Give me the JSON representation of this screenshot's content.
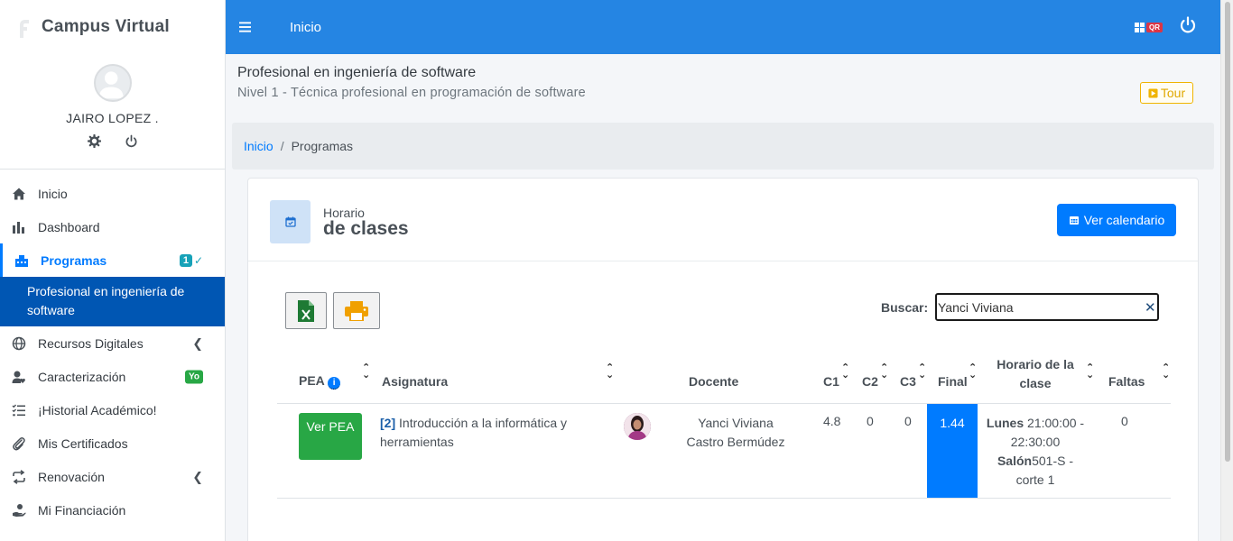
{
  "brand": {
    "name": "Campus Virtual"
  },
  "user": {
    "name": "JAIRO LOPEZ ."
  },
  "sidebar": {
    "items": [
      {
        "label": "Inicio"
      },
      {
        "label": "Dashboard"
      },
      {
        "label": "Programas",
        "badge": "1"
      },
      {
        "label": "Recursos Digitales"
      },
      {
        "label": "Caracterización",
        "badge": "Yo"
      },
      {
        "label": "¡Historial Académico!"
      },
      {
        "label": "Mis Certificados"
      },
      {
        "label": "Renovación"
      },
      {
        "label": "Mi Financiación"
      }
    ],
    "sub_item": "Profesional en ingeniería de software"
  },
  "topbar": {
    "title": "Inicio",
    "qr_label": "QR"
  },
  "header": {
    "title": "Profesional en ingeniería de software",
    "subtitle": "Nivel 1 - Técnica profesional en programación de software",
    "tour_label": "Tour"
  },
  "breadcrumb": {
    "home": "Inicio",
    "separator": "/",
    "current": "Programas"
  },
  "card": {
    "label_small": "Horario",
    "label_big": "de clases",
    "calendar_button": "Ver calendario"
  },
  "search": {
    "label": "Buscar:",
    "value": "Yanci Viviana"
  },
  "table": {
    "headers": {
      "pea": "PEA",
      "asignatura": "Asignatura",
      "docente": "Docente",
      "c1": "C1",
      "c2": "C2",
      "c3": "C3",
      "final": "Final",
      "horario": "Horario de la clase",
      "faltas": "Faltas"
    },
    "rows": [
      {
        "pea_button": "Ver PEA",
        "code": "[2]",
        "asignatura": "Introducción a la informática y herramientas",
        "docente": "Yanci Viviana Castro Bermúdez",
        "c1": "4.8",
        "c2": "0",
        "c3": "0",
        "final": "1.44",
        "horario_day": "Lunes",
        "horario_time": "21:00:00 - 22:30:00",
        "horario_salon_label": "Salón",
        "horario_salon": "501-S - corte 1",
        "faltas": "0"
      }
    ]
  },
  "colors": {
    "primary": "#007bff",
    "topbar": "#2585e3",
    "success": "#28a745",
    "sub_item_bg": "#0056b3",
    "tour": "#e0a800"
  }
}
